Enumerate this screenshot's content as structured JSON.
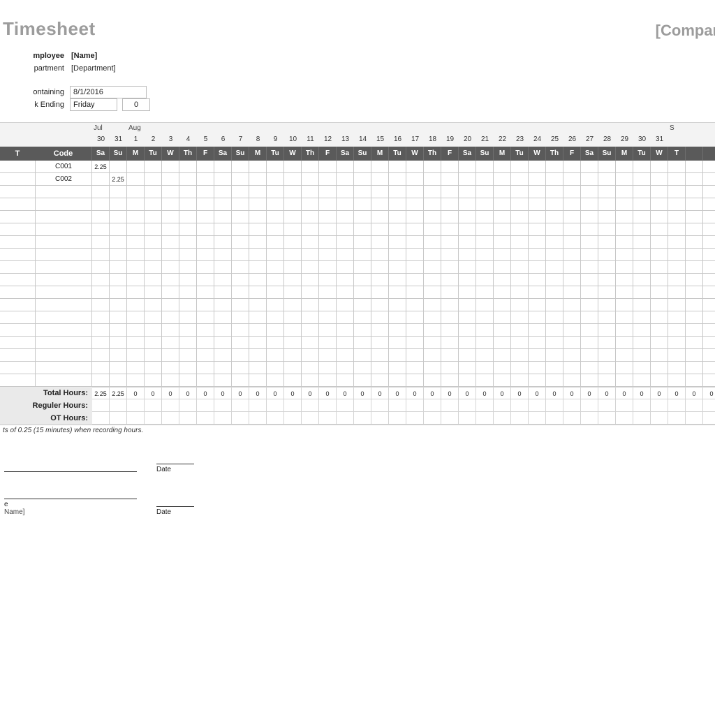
{
  "header": {
    "title": "Timesheet",
    "company": "[Compan"
  },
  "info": {
    "employee_label": "mployee",
    "employee_value": "[Name]",
    "department_label": "partment",
    "department_value": "[Department]",
    "containing_label": "ontaining",
    "containing_value": "8/1/2016",
    "weekending_label": "k Ending",
    "weekending_day": "Friday",
    "weekending_num": "0"
  },
  "grid": {
    "leftHeaderT": "T",
    "leftHeaderCode": "Code",
    "months": [
      {
        "at": 0,
        "label": "Jul"
      },
      {
        "at": 2,
        "label": "Aug"
      },
      {
        "at": 33,
        "label": "S"
      }
    ],
    "dates": [
      "30",
      "31",
      "1",
      "2",
      "3",
      "4",
      "5",
      "6",
      "7",
      "8",
      "9",
      "10",
      "11",
      "12",
      "13",
      "14",
      "15",
      "16",
      "17",
      "18",
      "19",
      "20",
      "21",
      "22",
      "23",
      "24",
      "25",
      "26",
      "27",
      "28",
      "29",
      "30",
      "31",
      "",
      "",
      ""
    ],
    "dows": [
      "Sa",
      "Su",
      "M",
      "Tu",
      "W",
      "Th",
      "F",
      "Sa",
      "Su",
      "M",
      "Tu",
      "W",
      "Th",
      "F",
      "Sa",
      "Su",
      "M",
      "Tu",
      "W",
      "Th",
      "F",
      "Sa",
      "Su",
      "M",
      "Tu",
      "W",
      "Th",
      "F",
      "Sa",
      "Su",
      "M",
      "Tu",
      "W",
      "T",
      "",
      ""
    ],
    "rows": [
      {
        "code": "C001",
        "cells": {
          "0": "2.25"
        }
      },
      {
        "code": "C002",
        "cells": {
          "1": "2.25"
        }
      },
      {
        "code": "",
        "cells": {}
      },
      {
        "code": "",
        "cells": {}
      },
      {
        "code": "",
        "cells": {}
      },
      {
        "code": "",
        "cells": {}
      },
      {
        "code": "",
        "cells": {}
      },
      {
        "code": "",
        "cells": {}
      },
      {
        "code": "",
        "cells": {}
      },
      {
        "code": "",
        "cells": {}
      },
      {
        "code": "",
        "cells": {}
      },
      {
        "code": "",
        "cells": {}
      },
      {
        "code": "",
        "cells": {}
      },
      {
        "code": "",
        "cells": {}
      },
      {
        "code": "",
        "cells": {}
      },
      {
        "code": "",
        "cells": {}
      },
      {
        "code": "",
        "cells": {}
      },
      {
        "code": "",
        "cells": {}
      }
    ]
  },
  "totals": {
    "labels": [
      "Total Hours:",
      "Reguler Hours:",
      "OT Hours:"
    ],
    "total_hours": [
      "2.25",
      "2.25",
      "0",
      "0",
      "0",
      "0",
      "0",
      "0",
      "0",
      "0",
      "0",
      "0",
      "0",
      "0",
      "0",
      "0",
      "0",
      "0",
      "0",
      "0",
      "0",
      "0",
      "0",
      "0",
      "0",
      "0",
      "0",
      "0",
      "0",
      "0",
      "0",
      "0",
      "0",
      "0",
      "0",
      "0"
    ]
  },
  "note": "ts of 0.25 (15 minutes) when recording hours.",
  "sign": {
    "line1_left": "",
    "line1_right": "Date",
    "line2_left": "e",
    "line2_sub": "Name]",
    "line2_right": "Date"
  },
  "chart_data": {
    "type": "table",
    "title": "Timesheet",
    "columns": [
      "Code",
      "Jul 30 Sa",
      "Jul 31 Su",
      "Aug 1 M",
      "Aug 2 Tu",
      "Aug 3 W",
      "Aug 4 Th",
      "Aug 5 F",
      "Aug 6 Sa",
      "Aug 7 Su",
      "Aug 8 M",
      "Aug 9 Tu",
      "Aug 10 W",
      "Aug 11 Th",
      "Aug 12 F",
      "Aug 13 Sa",
      "Aug 14 Su",
      "Aug 15 M",
      "Aug 16 Tu",
      "Aug 17 W",
      "Aug 18 Th",
      "Aug 19 F",
      "Aug 20 Sa",
      "Aug 21 Su",
      "Aug 22 M",
      "Aug 23 Tu",
      "Aug 24 W",
      "Aug 25 Th",
      "Aug 26 F",
      "Aug 27 Sa",
      "Aug 28 Su",
      "Aug 29 M",
      "Aug 30 Tu",
      "Aug 31 W"
    ],
    "rows": [
      [
        "C001",
        2.25,
        null,
        null,
        null,
        null,
        null,
        null,
        null,
        null,
        null,
        null,
        null,
        null,
        null,
        null,
        null,
        null,
        null,
        null,
        null,
        null,
        null,
        null,
        null,
        null,
        null,
        null,
        null,
        null,
        null,
        null,
        null,
        null
      ],
      [
        "C002",
        null,
        2.25,
        null,
        null,
        null,
        null,
        null,
        null,
        null,
        null,
        null,
        null,
        null,
        null,
        null,
        null,
        null,
        null,
        null,
        null,
        null,
        null,
        null,
        null,
        null,
        null,
        null,
        null,
        null,
        null,
        null,
        null,
        null
      ]
    ],
    "totals": {
      "Total Hours": [
        2.25,
        2.25,
        0,
        0,
        0,
        0,
        0,
        0,
        0,
        0,
        0,
        0,
        0,
        0,
        0,
        0,
        0,
        0,
        0,
        0,
        0,
        0,
        0,
        0,
        0,
        0,
        0,
        0,
        0,
        0,
        0,
        0,
        0
      ]
    }
  }
}
